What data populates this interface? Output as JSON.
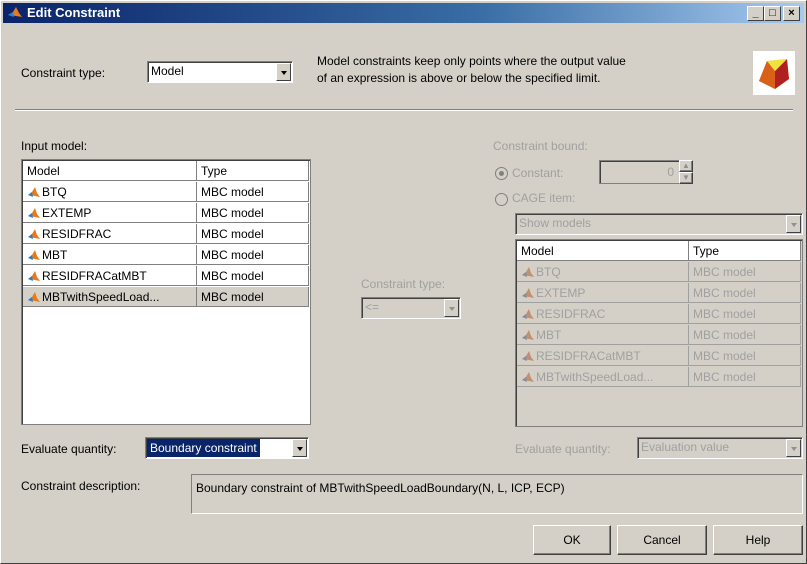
{
  "window": {
    "title": "Edit Constraint",
    "min": "_",
    "max": "□",
    "close": "×"
  },
  "header": {
    "constraint_type_label": "Constraint type:",
    "constraint_type_value": "Model",
    "info_text_1": "Model constraints keep only points where the output value",
    "info_text_2": "of an expression is above or below the specified limit."
  },
  "input_model": {
    "label": "Input model:",
    "columns": [
      "Model",
      "Type"
    ],
    "rows": [
      {
        "model": "BTQ",
        "type": "MBC model"
      },
      {
        "model": "EXTEMP",
        "type": "MBC model"
      },
      {
        "model": "RESIDFRAC",
        "type": "MBC model"
      },
      {
        "model": "MBT",
        "type": "MBC model"
      },
      {
        "model": "RESIDFRACatMBT",
        "type": "MBC model"
      },
      {
        "model": "MBTwithSpeedLoad...",
        "type": "MBC model"
      }
    ]
  },
  "middle": {
    "constraint_type_label": "Constraint type:",
    "operator_value": "<="
  },
  "bound": {
    "label": "Constraint bound:",
    "constant_label": "Constant:",
    "constant_value": "0",
    "cage_item_label": "CAGE item:",
    "show_models_value": "Show models",
    "columns": [
      "Model",
      "Type"
    ],
    "rows": [
      {
        "model": "BTQ",
        "type": "MBC model"
      },
      {
        "model": "EXTEMP",
        "type": "MBC model"
      },
      {
        "model": "RESIDFRAC",
        "type": "MBC model"
      },
      {
        "model": "MBT",
        "type": "MBC model"
      },
      {
        "model": "RESIDFRACatMBT",
        "type": "MBC model"
      },
      {
        "model": "MBTwithSpeedLoad...",
        "type": "MBC model"
      }
    ],
    "evaluate_label": "Evaluate quantity:",
    "evaluate_value": "Evaluation value"
  },
  "evaluate": {
    "label": "Evaluate quantity:",
    "value": "Boundary constraint"
  },
  "description": {
    "label": "Constraint description:",
    "text": "Boundary constraint of MBTwithSpeedLoadBoundary(N, L, ICP, ECP)"
  },
  "buttons": {
    "ok": "OK",
    "cancel": "Cancel",
    "help": "Help"
  },
  "colors": {
    "title_start": "#0a246a",
    "title_end": "#a6caf0",
    "dialog_bg": "#d4d0c8",
    "selection": "#0a246a"
  }
}
